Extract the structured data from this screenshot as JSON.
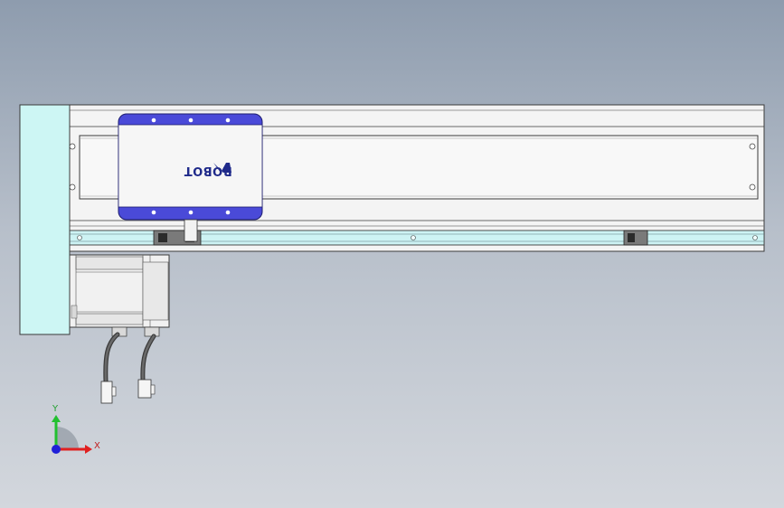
{
  "logo": {
    "text": "ROBOT"
  },
  "triad": {
    "x_label": "X",
    "y_label": "Y"
  },
  "colors": {
    "background_top": "#8e9cae",
    "background_bottom": "#d3d7dd",
    "end_cap": "#cdf6f4",
    "carriage_band": "#4a4ad8",
    "rail": "#cdf3f4",
    "axis_x": "#e02020",
    "axis_y": "#22c030",
    "axis_origin": "#2020d8"
  }
}
